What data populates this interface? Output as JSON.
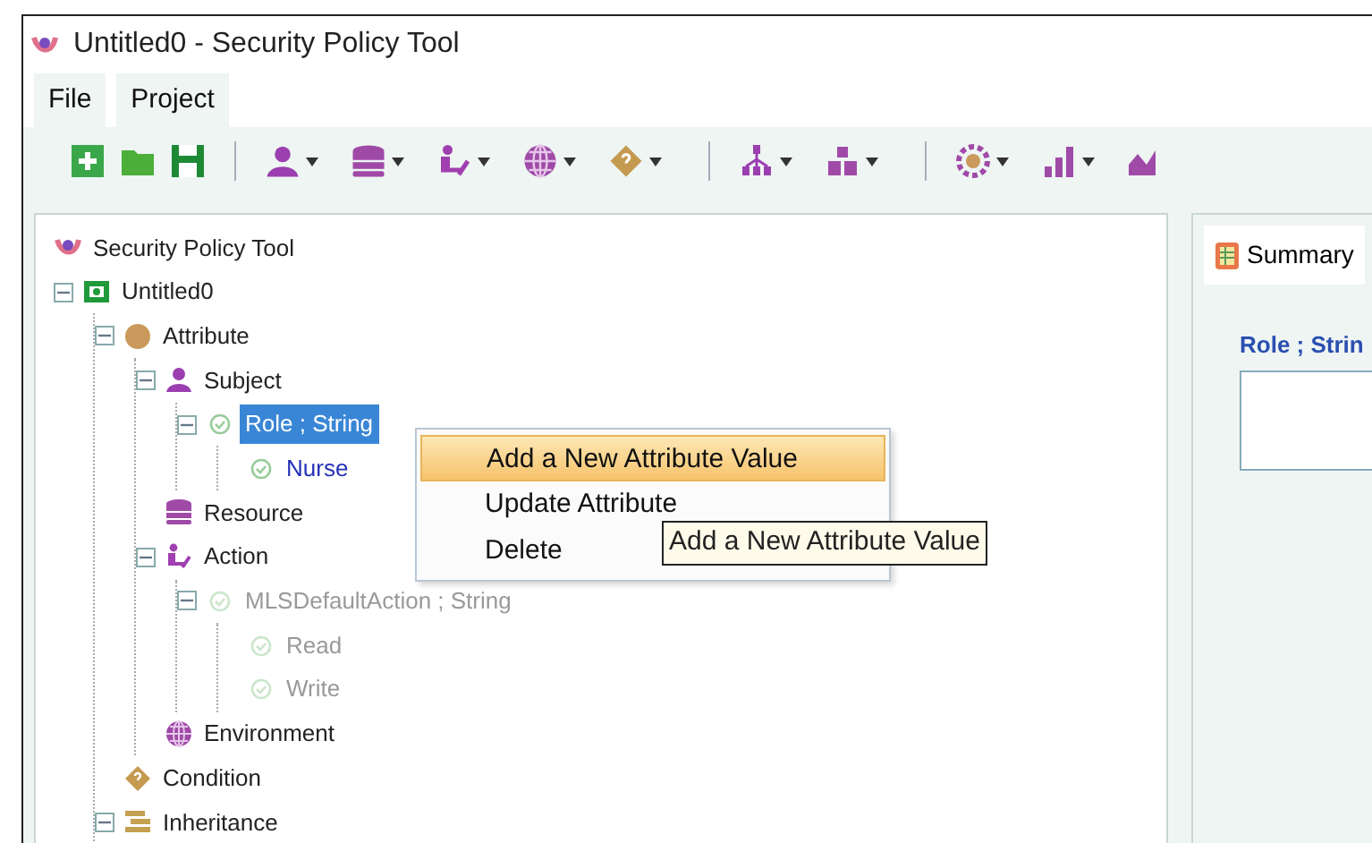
{
  "window": {
    "title": "Untitled0 - Security Policy Tool"
  },
  "menu": [
    {
      "label": "File"
    },
    {
      "label": "Project"
    }
  ],
  "toolbar": [
    {
      "kind": "new",
      "has_menu": false
    },
    {
      "kind": "open",
      "has_menu": false
    },
    {
      "kind": "save",
      "has_menu": false
    },
    {
      "kind": "separator"
    },
    {
      "kind": "subject",
      "has_menu": true
    },
    {
      "kind": "resource",
      "has_menu": true
    },
    {
      "kind": "action",
      "has_menu": true
    },
    {
      "kind": "environment",
      "has_menu": true
    },
    {
      "kind": "condition",
      "has_menu": true
    },
    {
      "kind": "separator"
    },
    {
      "kind": "hierarchy",
      "has_menu": true
    },
    {
      "kind": "blocks",
      "has_menu": true
    },
    {
      "kind": "separator"
    },
    {
      "kind": "gear",
      "has_menu": true
    },
    {
      "kind": "barchart",
      "has_menu": true
    },
    {
      "kind": "linechart",
      "has_menu": false
    }
  ],
  "tree": [
    {
      "label": "Security Policy Tool",
      "kind": "app",
      "selected": false,
      "disabled": false,
      "children": [
        {
          "label": "Untitled0",
          "kind": "project",
          "selected": false,
          "disabled": false,
          "expanded": true,
          "children": [
            {
              "label": "Attribute",
              "kind": "attribute",
              "selected": false,
              "disabled": false,
              "expanded": true,
              "children": [
                {
                  "label": "Subject",
                  "kind": "subject",
                  "selected": false,
                  "disabled": false,
                  "expanded": true,
                  "children": [
                    {
                      "label": "Role ; String",
                      "kind": "attr",
                      "selected": true,
                      "disabled": false,
                      "expanded": true,
                      "children": [
                        {
                          "label": "Nurse",
                          "kind": "value",
                          "selected": false,
                          "disabled": false
                        }
                      ]
                    }
                  ]
                },
                {
                  "label": "Resource",
                  "kind": "resource",
                  "selected": false,
                  "disabled": false
                },
                {
                  "label": "Action",
                  "kind": "action",
                  "selected": false,
                  "disabled": false,
                  "expanded": true,
                  "children": [
                    {
                      "label": "MLSDefaultAction ; String",
                      "kind": "attr",
                      "selected": false,
                      "disabled": true,
                      "expanded": true,
                      "children": [
                        {
                          "label": "Read",
                          "kind": "value",
                          "selected": false,
                          "disabled": true
                        },
                        {
                          "label": "Write",
                          "kind": "value",
                          "selected": false,
                          "disabled": true
                        }
                      ]
                    }
                  ]
                },
                {
                  "label": "Environment",
                  "kind": "environment",
                  "selected": false,
                  "disabled": false
                }
              ]
            },
            {
              "label": "Condition",
              "kind": "condition",
              "selected": false,
              "disabled": false
            },
            {
              "label": "Inheritance",
              "kind": "inheritance",
              "selected": false,
              "disabled": false,
              "expanded": true
            }
          ]
        }
      ]
    }
  ],
  "context_menu": {
    "items": [
      {
        "label": "Add a New Attribute Value",
        "selected": true
      },
      {
        "label": "Update Attribute",
        "selected": false
      },
      {
        "label": "Delete",
        "selected": false
      }
    ]
  },
  "tooltip": {
    "text": "Add a New Attribute Value"
  },
  "summary": {
    "tab": "Summary",
    "heading": "Role ; Strin"
  }
}
